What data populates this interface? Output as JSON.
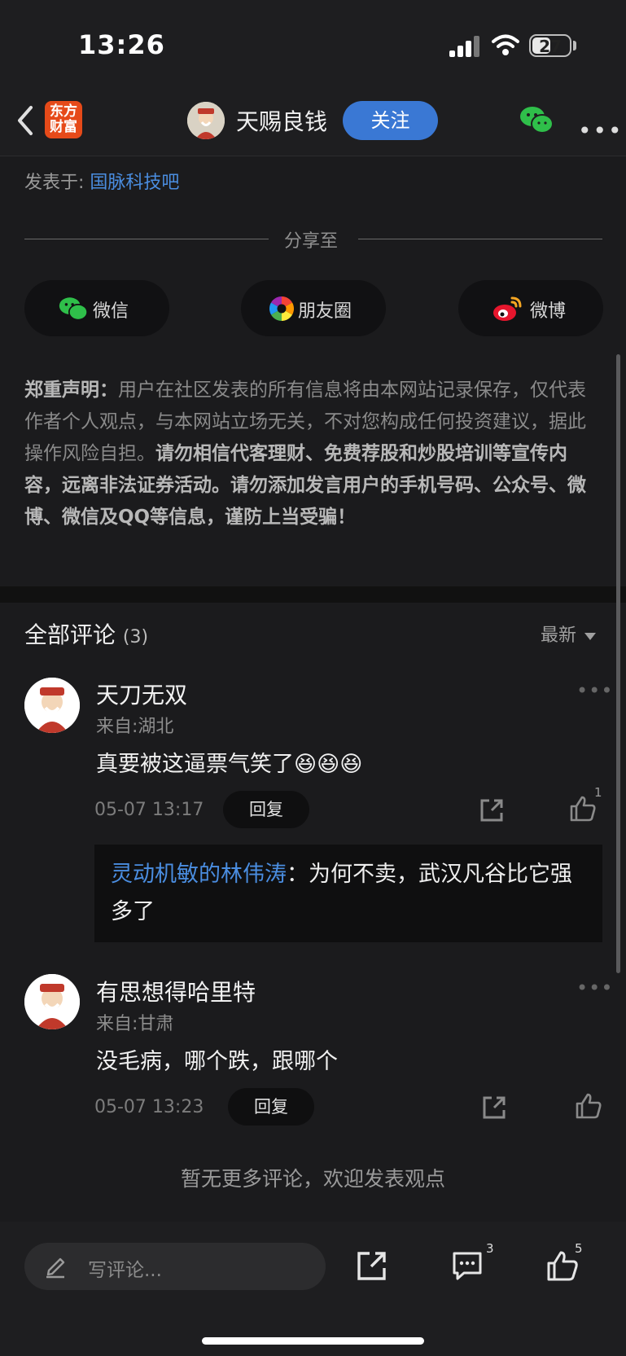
{
  "status_bar": {
    "time": "13:26",
    "battery": "27"
  },
  "nav": {
    "logo_text": "东方财富",
    "author": "天赐良钱",
    "follow_label": "关注"
  },
  "post": {
    "posted_label": "发表于:",
    "posted_forum": "国脉科技吧"
  },
  "share": {
    "title": "分享至",
    "buttons": [
      {
        "label": "微信",
        "icon": "wechat-icon"
      },
      {
        "label": "朋友圈",
        "icon": "moments-icon"
      },
      {
        "label": "微博",
        "icon": "weibo-icon"
      }
    ]
  },
  "disclaimer": {
    "heading": "郑重声明：",
    "body": "用户在社区发表的所有信息将由本网站记录保存，仅代表作者个人观点，与本网站立场无关，不对您构成任何投资建议，据此操作风险自担。",
    "bold": "请勿相信代客理财、免费荐股和炒股培训等宣传内容，远离非法证券活动。请勿添加发言用户的手机号码、公众号、微博、微信及QQ等信息，谨防上当受骗！"
  },
  "comments": {
    "title": "全部评论",
    "count": "(3)",
    "sort_label": "最新",
    "items": [
      {
        "name": "天刀无双",
        "location": "来自:湖北",
        "text": "真要被这逼票气笑了😆😆😆",
        "date": "05-07 13:17",
        "reply_label": "回复",
        "like_count": "1",
        "sub_reply": {
          "user": "灵动机敏的林伟涛",
          "text": "：为何不卖，武汉凡谷比它强多了"
        }
      },
      {
        "name": "有思想得哈里特",
        "location": "来自:甘肃",
        "text": "没毛病，哪个跌，跟哪个",
        "date": "05-07 13:23",
        "reply_label": "回复"
      }
    ],
    "no_more": "暂无更多评论，欢迎发表观点"
  },
  "bottom_bar": {
    "placeholder": "写评论...",
    "comment_count": "3",
    "like_count": "5"
  },
  "colors": {
    "accent": "#3a78d4",
    "link": "#4a8de0",
    "background": "#1b1b1d"
  }
}
